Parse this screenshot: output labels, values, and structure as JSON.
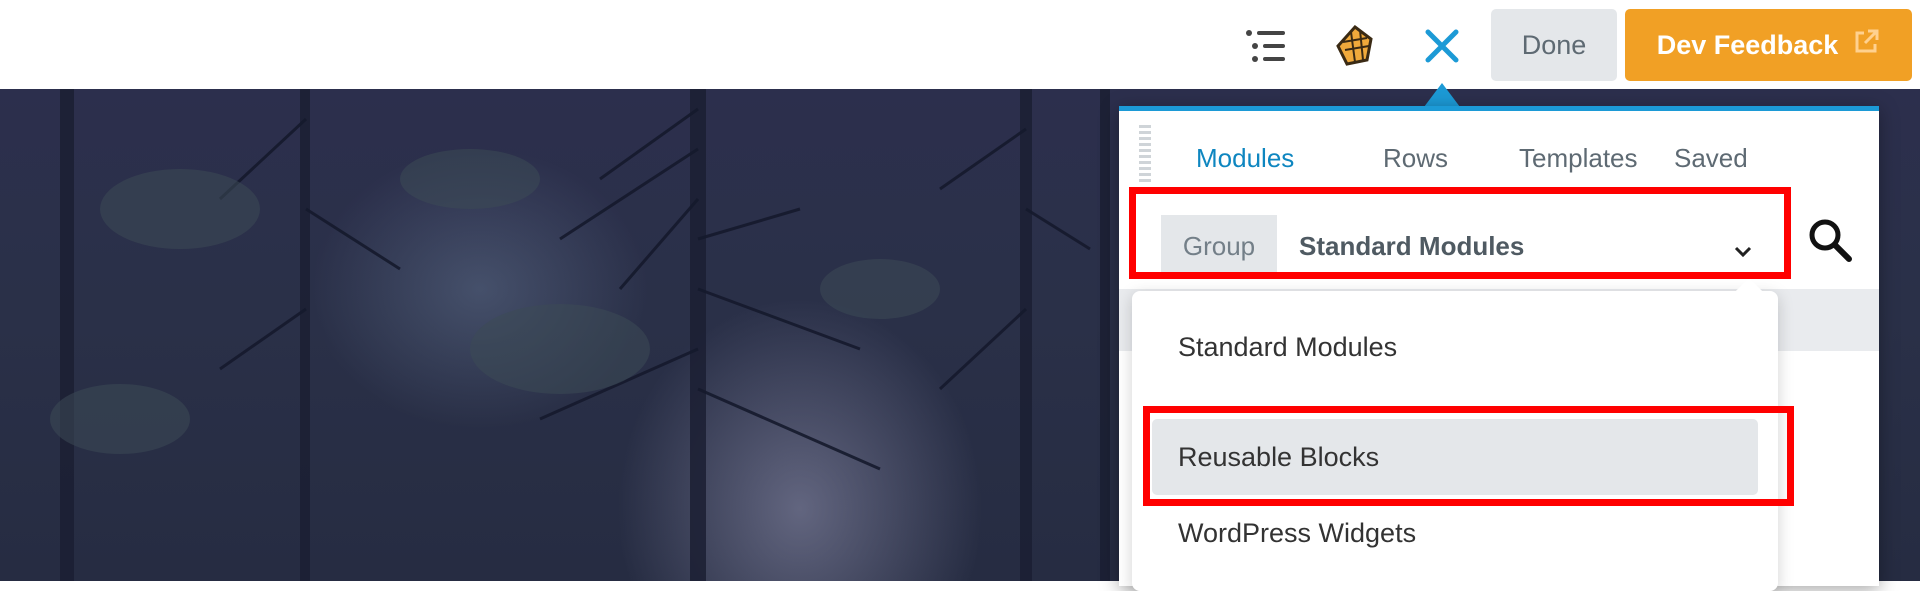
{
  "toolbar": {
    "outline_icon": "list-outline-icon",
    "user_icon": "assistant-icon",
    "close_icon": "close-icon",
    "done_label": "Done",
    "feedback_label": "Dev Feedback",
    "feedback_icon": "external-link-icon",
    "accent_color": "#1c9ad6",
    "feedback_color": "#f1a025"
  },
  "panel": {
    "tabs": [
      {
        "label": "Modules",
        "active": true
      },
      {
        "label": "Rows",
        "active": false
      },
      {
        "label": "Templates",
        "active": false
      },
      {
        "label": "Saved",
        "active": false
      }
    ],
    "group": {
      "label": "Group",
      "selected": "Standard Modules"
    },
    "dropdown": {
      "options": [
        "Standard Modules",
        "Reusable Blocks",
        "WordPress Widgets"
      ],
      "highlighted": "Reusable Blocks"
    }
  },
  "highlight_color": "#ff0000"
}
